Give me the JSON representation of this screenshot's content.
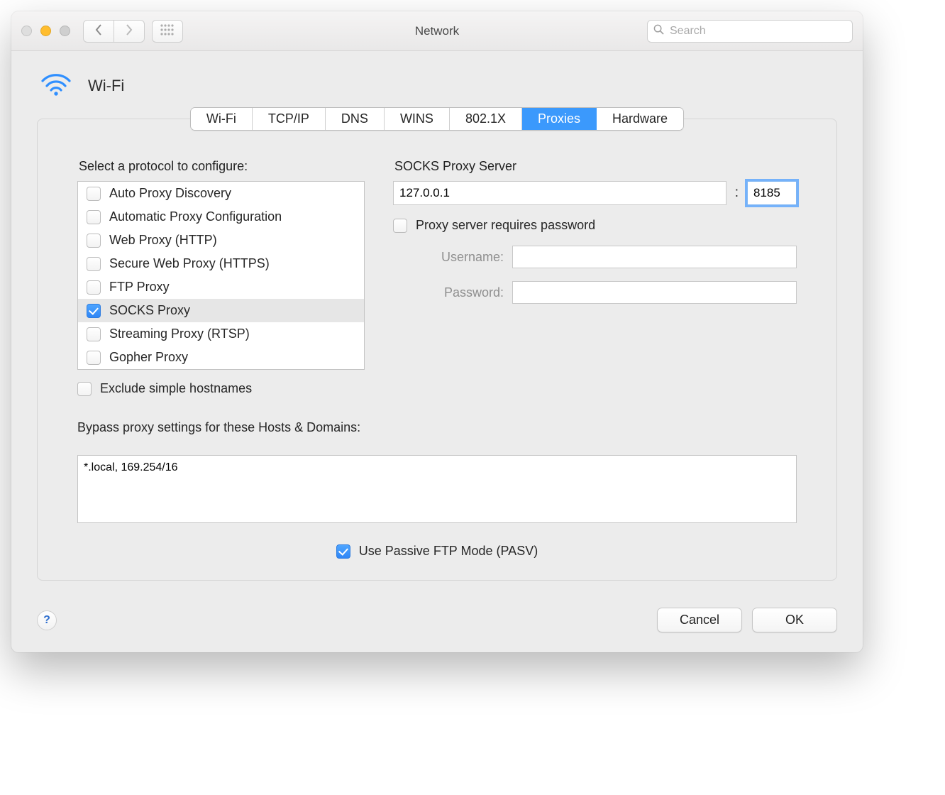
{
  "window": {
    "title": "Network"
  },
  "search": {
    "placeholder": "Search"
  },
  "header": {
    "interface_name": "Wi-Fi"
  },
  "tabs": [
    {
      "label": "Wi-Fi",
      "active": false
    },
    {
      "label": "TCP/IP",
      "active": false
    },
    {
      "label": "DNS",
      "active": false
    },
    {
      "label": "WINS",
      "active": false
    },
    {
      "label": "802.1X",
      "active": false
    },
    {
      "label": "Proxies",
      "active": true
    },
    {
      "label": "Hardware",
      "active": false
    }
  ],
  "protocols_section_label": "Select a protocol to configure:",
  "protocols": [
    {
      "label": "Auto Proxy Discovery",
      "checked": false,
      "selected": false
    },
    {
      "label": "Automatic Proxy Configuration",
      "checked": false,
      "selected": false
    },
    {
      "label": "Web Proxy (HTTP)",
      "checked": false,
      "selected": false
    },
    {
      "label": "Secure Web Proxy (HTTPS)",
      "checked": false,
      "selected": false
    },
    {
      "label": "FTP Proxy",
      "checked": false,
      "selected": false
    },
    {
      "label": "SOCKS Proxy",
      "checked": true,
      "selected": true
    },
    {
      "label": "Streaming Proxy (RTSP)",
      "checked": false,
      "selected": false
    },
    {
      "label": "Gopher Proxy",
      "checked": false,
      "selected": false
    }
  ],
  "exclude_simple": {
    "label": "Exclude simple hostnames",
    "checked": false
  },
  "right": {
    "server_heading": "SOCKS Proxy Server",
    "host": "127.0.0.1",
    "port": "8185",
    "requires_password_label": "Proxy server requires password",
    "requires_password_checked": false,
    "username_label": "Username:",
    "password_label": "Password:",
    "username_value": "",
    "password_value": ""
  },
  "bypass": {
    "label": "Bypass proxy settings for these Hosts & Domains:",
    "value": "*.local, 169.254/16"
  },
  "pasv": {
    "label": "Use Passive FTP Mode (PASV)",
    "checked": true
  },
  "buttons": {
    "cancel": "Cancel",
    "ok": "OK"
  }
}
